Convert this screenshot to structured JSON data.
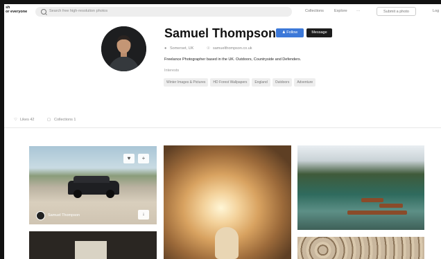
{
  "nav": {
    "logo_lines": [
      "sh",
      "or everyone"
    ],
    "search_placeholder": "Search free high-resolution photos",
    "links": [
      "Collections",
      "Explore",
      "···"
    ],
    "submit_label": "Submit a photo",
    "login_label": "Log"
  },
  "profile": {
    "name": "Samuel Thompson",
    "follow_label": "Follow",
    "message_label": "Message",
    "location": "Somerset, UK",
    "website": "samuelthompson.co.uk",
    "bio": "Freelance Photographer based in the UK. Outdoors, Countryside and Defenders.",
    "interests_label": "Interests",
    "tags": [
      "Winter Images & Pictures",
      "HD Forest Wallpapers",
      "England",
      "Outdoors",
      "Adventure"
    ]
  },
  "tabs": {
    "likes_label": "Likes 42",
    "collections_label": "Collections 1"
  },
  "photos": {
    "owner_name": "Samuel Thompson"
  },
  "icons": {
    "follow": "person-plus-icon",
    "location": "pin-icon",
    "website": "globe-icon",
    "likes": "heart-icon",
    "collections": "stack-icon",
    "heart": "heart-icon",
    "add": "plus-icon",
    "download": "arrow-down-icon"
  },
  "colors": {
    "follow_bg": "#3c78d8",
    "message_bg": "#1c1c1c"
  }
}
